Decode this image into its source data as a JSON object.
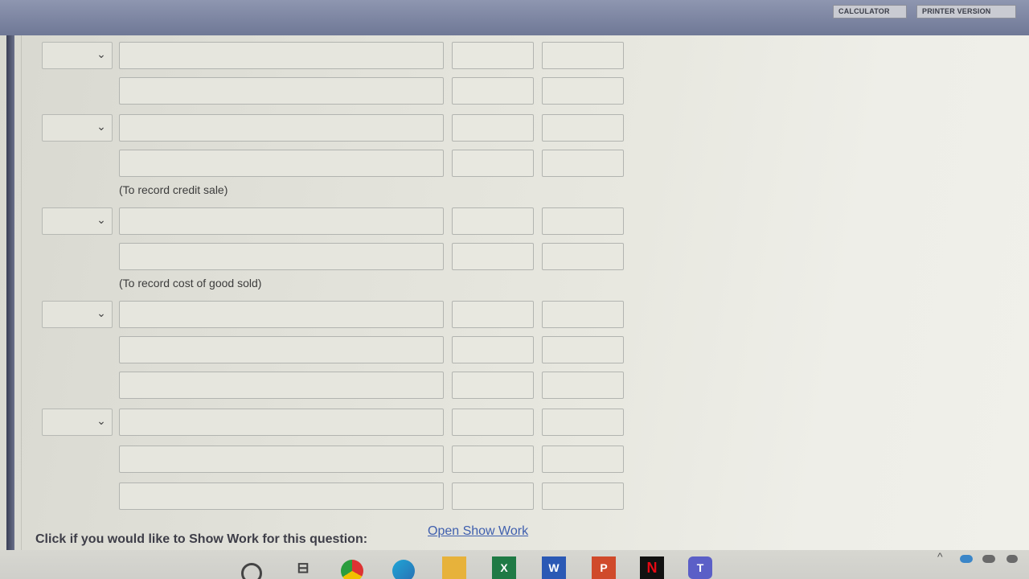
{
  "header": {
    "calculator_label": "CALCULATOR",
    "printer_label": "PRINTER VERSION"
  },
  "journal": {
    "notes": [
      "(To record credit sale)",
      "(To record cost of good sold)"
    ]
  },
  "footer": {
    "prompt": "Click if you would like to Show Work for this question:",
    "link": "Open Show Work"
  },
  "taskbar": {
    "icons": [
      "search-icon",
      "task-view-icon",
      "chrome-icon",
      "edge-icon",
      "file-explorer-icon",
      "excel-icon",
      "word-icon",
      "powerpoint-icon",
      "netflix-icon",
      "teams-icon"
    ],
    "taskview_glyph": "⊟",
    "excel_glyph": "X",
    "word_glyph": "W",
    "ppt_glyph": "P",
    "netflix_glyph": "N",
    "teams_glyph": "T",
    "tray_caret": "^"
  },
  "colors": {
    "header_bar": "#7a83a1",
    "link": "#3f5fae",
    "field_border": "#b2b4b0"
  }
}
